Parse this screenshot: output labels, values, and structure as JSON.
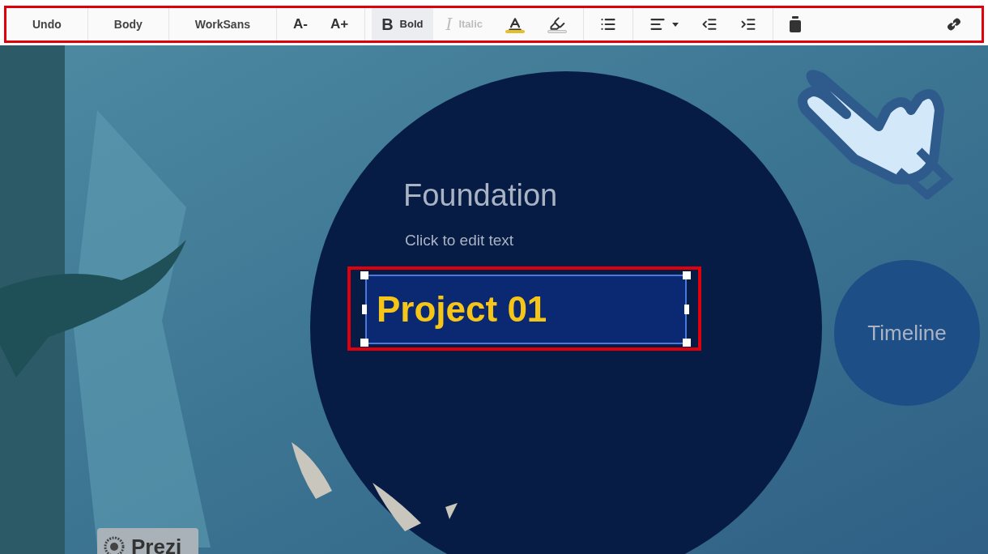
{
  "toolbar": {
    "groups": [
      {
        "items": [
          {
            "kind": "text",
            "label": "Undo"
          }
        ]
      },
      {
        "items": [
          {
            "kind": "text",
            "label": "Body"
          }
        ]
      },
      {
        "items": [
          {
            "kind": "text",
            "label": "WorkSans"
          }
        ]
      },
      {
        "items": [
          {
            "kind": "size",
            "label": "A-"
          },
          {
            "kind": "size",
            "label": "A+"
          }
        ]
      },
      {
        "items": [
          {
            "kind": "style",
            "glyph": "B",
            "label": "Bold",
            "selected": true,
            "disabled": false
          },
          {
            "kind": "style",
            "glyph": "I",
            "label": "Italic",
            "selected": false,
            "disabled": true
          },
          {
            "kind": "icon",
            "color": "#e3bf2a"
          },
          {
            "kind": "icon",
            "color": "#e6e6e6"
          }
        ]
      },
      {
        "items": [
          {
            "kind": "icon"
          }
        ]
      },
      {
        "items": [
          {
            "kind": "icon"
          },
          {
            "kind": "icon"
          },
          {
            "kind": "icon"
          }
        ]
      },
      {
        "items": [
          {
            "kind": "icon"
          },
          {
            "kind": "icon"
          }
        ]
      }
    ]
  },
  "canvas": {
    "title": "Foundation",
    "subtitle": "Click to edit text",
    "textbox": {
      "text": "Project 01",
      "selected": true
    },
    "topic": "Timeline",
    "logo": "Prezi"
  }
}
